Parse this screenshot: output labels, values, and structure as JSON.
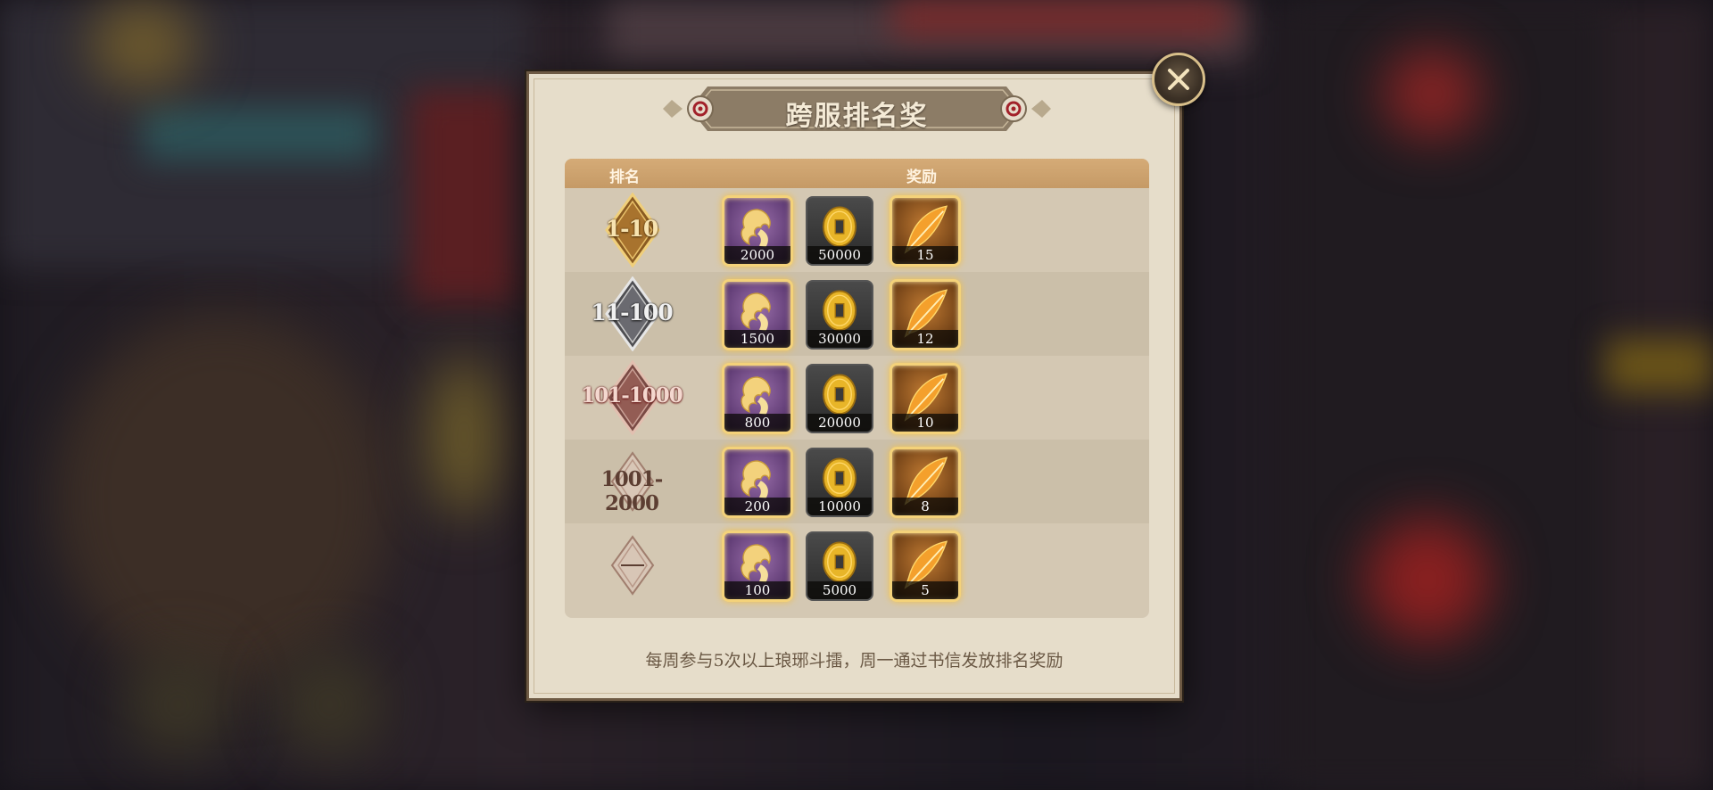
{
  "popup": {
    "title": "跨服排名奖",
    "columns": {
      "rank": "排名",
      "reward": "奖励"
    },
    "rows": [
      {
        "rank": "1-10",
        "tier": "gold",
        "rewards": [
          "2000",
          "50000",
          "15"
        ]
      },
      {
        "rank": "11-100",
        "tier": "silver",
        "rewards": [
          "1500",
          "30000",
          "12"
        ]
      },
      {
        "rank": "101-1000",
        "tier": "bronze",
        "rewards": [
          "800",
          "20000",
          "10"
        ]
      },
      {
        "rank": "1001-2000",
        "tier": "plain",
        "rewards": [
          "200",
          "10000",
          "8"
        ]
      },
      {
        "rank": "",
        "tier": "plain",
        "rewards": [
          "100",
          "5000",
          "5"
        ]
      }
    ],
    "reward_icons": [
      "dragon-token-icon",
      "coin-icon",
      "feather-icon"
    ],
    "footer": "每周参与5次以上琅琊斗擂，周一通过书信发放排名奖励",
    "colors": {
      "panel": "#e6ddca",
      "header": "#c59a66",
      "gold_border": "#f4d27a"
    }
  }
}
